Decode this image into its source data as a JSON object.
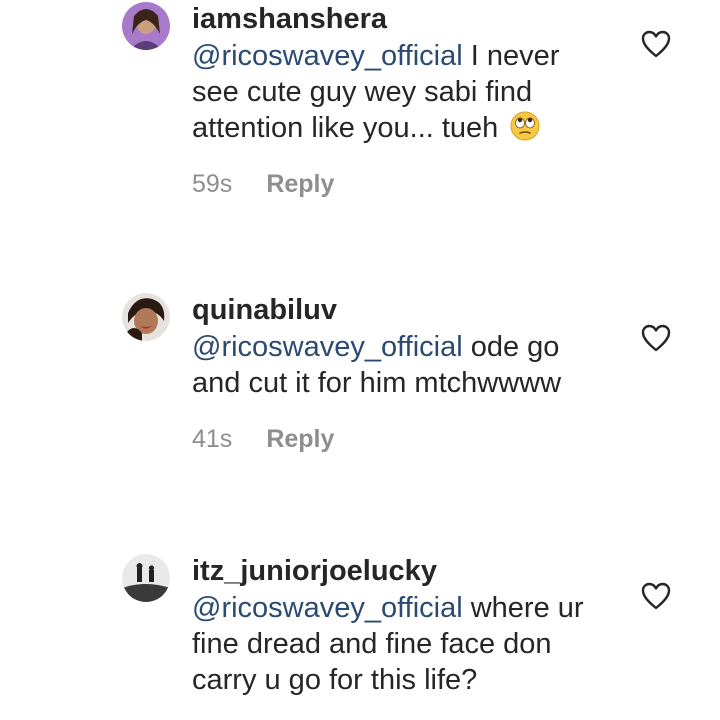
{
  "comments": [
    {
      "username": "iamshanshera",
      "mention": "@ricoswavey_official",
      "text": " I never see cute guy wey sabi find attention like you... tueh ",
      "emoji_icon": "face-with-rolling-eyes-icon",
      "time": "59s",
      "reply_label": "Reply"
    },
    {
      "username": "quinabiluv",
      "mention": "@ricoswavey_official",
      "text": " ode go and cut  it for him mtchwwww",
      "time": "41s",
      "reply_label": "Reply"
    },
    {
      "username": "itz_juniorjoelucky",
      "mention": "@ricoswavey_official",
      "text": " where ur fine dread and fine face don carry u go for this life?"
    }
  ],
  "icons": {
    "like": "heart-outline-icon"
  },
  "colors": {
    "mention": "#2b4a72",
    "meta": "#8e8e8e",
    "text": "#262626"
  }
}
